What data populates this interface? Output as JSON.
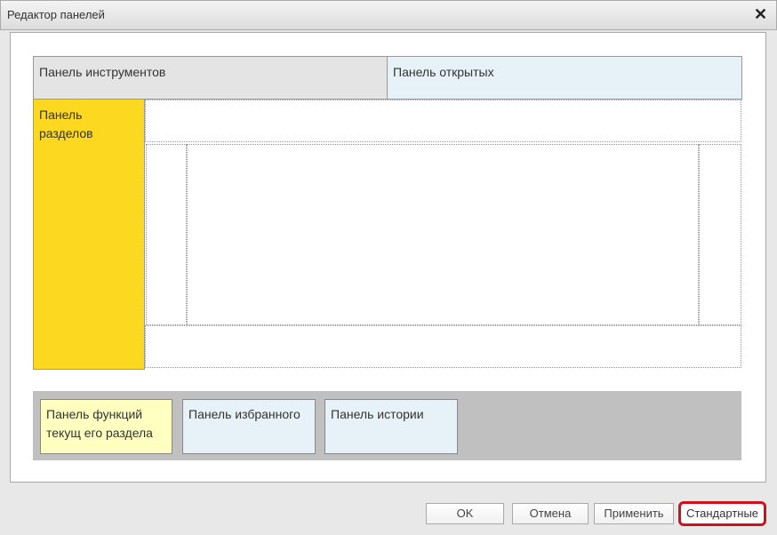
{
  "window": {
    "title": "Редактор панелей",
    "close_icon": "close-icon"
  },
  "panels": {
    "toolbar": "Панель инструментов",
    "open": "Панель открытых",
    "sections": "Панель разделов",
    "functions": "Панель функций текущ его раздела",
    "favorites": "Панель избранного",
    "history": "Панель истории"
  },
  "buttons": {
    "ok": "OK",
    "cancel": "Отмена",
    "apply": "Применить",
    "defaults": "Стандартные"
  },
  "colors": {
    "sections": "#fcd920",
    "functions": "#ffffc0",
    "open": "#e6f2f8",
    "toolbar": "#e4e4e4",
    "highlight": "#d0101c"
  }
}
